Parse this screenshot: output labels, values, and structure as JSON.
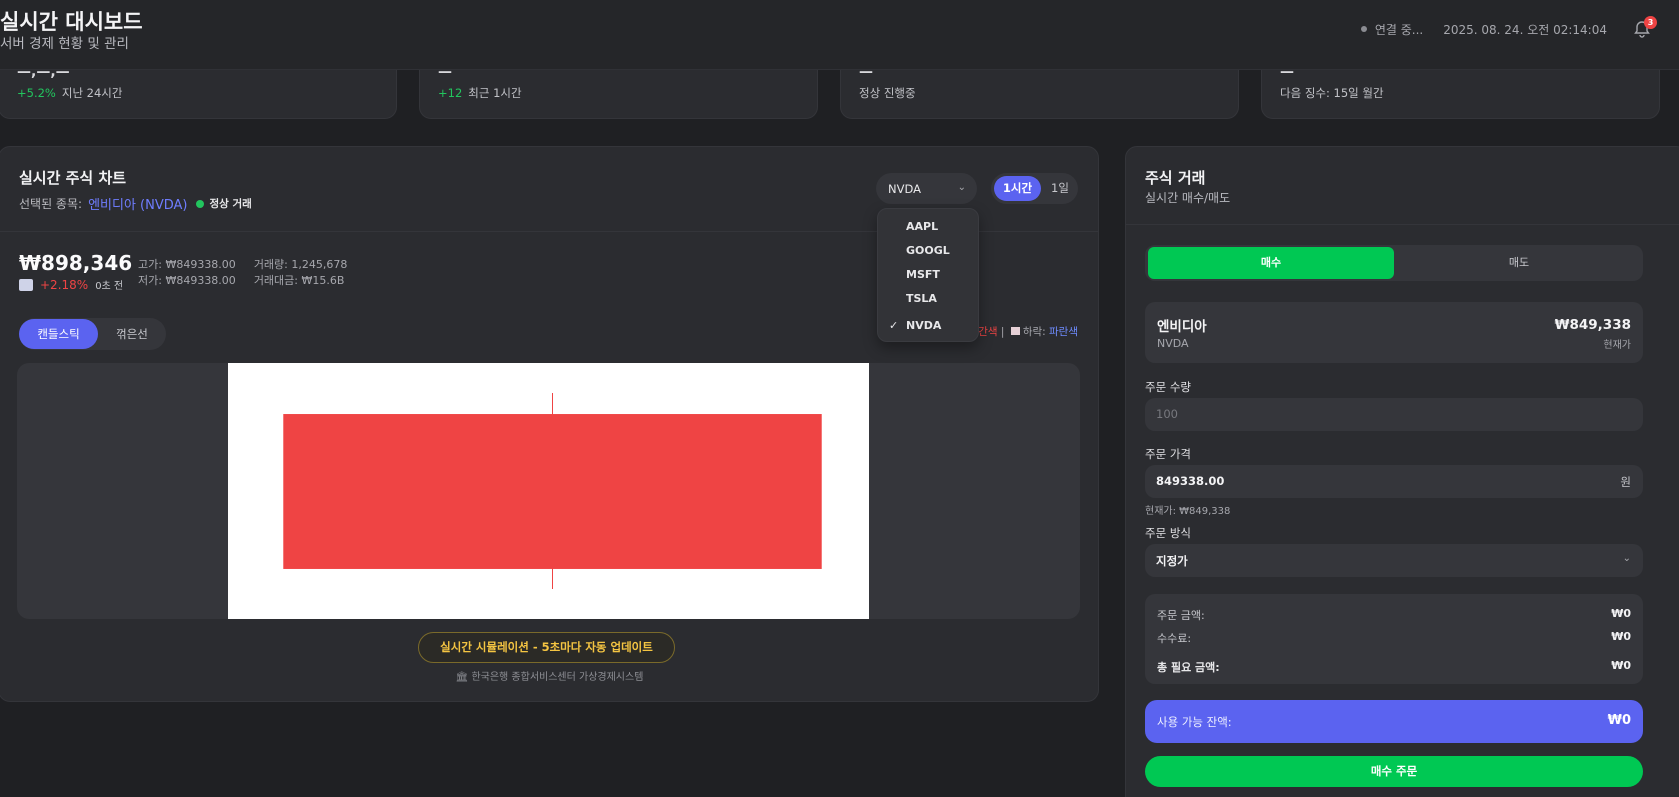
{
  "header": {
    "title": "실시간 대시보드",
    "subtitle": "서버 경제 현황 및 관리",
    "connection": "연결 중...",
    "datetime": "2025. 08. 24. 오전 02:14:04",
    "notification_count": "3"
  },
  "stats": [
    {
      "value": "—,—,—",
      "change": "+5.2%",
      "label": "지난 24시간"
    },
    {
      "value": "—",
      "change": "+12",
      "label": "최근 1시간"
    },
    {
      "value": "—",
      "change": "",
      "label": "정상 진행중"
    },
    {
      "value": "—",
      "change": "",
      "label": "다음 징수: 15일  월간"
    }
  ],
  "chart_panel": {
    "title": "실시간 주식 차트",
    "selected_label": "선택된 종목:",
    "selected_stock": "엔비디아 (NVDA)",
    "status": "정상 거래",
    "ticker": "NVDA",
    "periods": [
      "1시간",
      "1일"
    ],
    "price": "₩898,346",
    "change_pct": "+2.18%",
    "updated": "0초 전",
    "high": "고가: ₩849338.00",
    "low": "저가: ₩849338.00",
    "volume": "거래량: 1,245,678",
    "turnover": "거래대금: ₩15.6B",
    "chart_types": [
      "캔들스틱",
      "꺾은선"
    ],
    "legend_up_text": "간색",
    "legend_sep": "|",
    "legend_down_label": "하락:",
    "legend_down_text": "파란색",
    "sim_button": "실시간 시뮬레이션 - 5초마다 자동 업데이트",
    "footer": "🏛 한국은행 종합서비스센터 가상경제시스템"
  },
  "dropdown": {
    "options": [
      "AAPL",
      "GOOGL",
      "MSFT",
      "TSLA",
      "NVDA"
    ],
    "selected": "NVDA"
  },
  "chart_data": {
    "type": "candlestick",
    "candles": [
      {
        "open": 898346,
        "close": 849338,
        "high": 905000,
        "low": 843000
      }
    ],
    "colors": {
      "up": "#ef4444",
      "down": "#6f8cff"
    }
  },
  "trade": {
    "title": "주식 거래",
    "subtitle": "실시간 매수/매도",
    "tabs": [
      "매수",
      "매도"
    ],
    "stock_name": "엔비디아",
    "stock_ticker": "NVDA",
    "stock_price": "₩849,338",
    "stock_price_label": "현재가",
    "qty_label": "주문 수량",
    "qty_placeholder": "100",
    "price_label": "주문 가격",
    "price_value": "849338.00",
    "price_unit": "원",
    "current_hint": "현재가: ₩849,338",
    "method_label": "주문 방식",
    "method_value": "지정가",
    "order_amount_label": "주문 금액:",
    "order_amount": "₩0",
    "fee_label": "수수료:",
    "fee": "₩0",
    "total_label": "총 필요 금액:",
    "total": "₩0",
    "balance_label": "사용 가능 잔액:",
    "balance": "₩0",
    "submit": "매수 주문"
  },
  "colors": {
    "accent": "#5b63f0",
    "buy": "#00c853",
    "down_red": "#ef4444"
  }
}
